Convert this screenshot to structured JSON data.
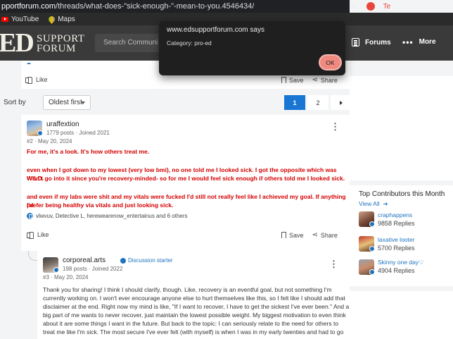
{
  "browser": {
    "url_host": "pportforum.com",
    "url_path": "/threads/what-does-\"sick-enough-\"-mean-to-you.4546434/",
    "ext_label": "Te",
    "bookmarks": [
      {
        "label": "YouTube",
        "icon": "youtube-icon"
      },
      {
        "label": "Maps",
        "icon": "maps-icon"
      }
    ]
  },
  "header": {
    "logo_mark": "ED",
    "logo_line1": "SUPPORT",
    "logo_line2": "FORUM",
    "search_placeholder": "Search Communi",
    "nav": [
      {
        "label": "Forums",
        "icon": "forums-icon"
      },
      {
        "label": "More",
        "icon": "more-dots-icon"
      }
    ]
  },
  "dialog": {
    "title": "www.edsupportforum.com says",
    "message": "Category: pro-ed",
    "ok_label": "OK"
  },
  "prev_post": {
    "like_label": "Like",
    "save_label": "Save",
    "share_label": "Share"
  },
  "sort": {
    "label": "Sort by",
    "selected": "Oldest first",
    "pages": [
      "1",
      "2"
    ],
    "current_page": "1"
  },
  "posts": [
    {
      "username": "uraffextion",
      "meta": "1779 posts · Joined 2021",
      "post_meta": "#2 · May 20, 2024",
      "paragraphs": [
        "For me, it's a look. It's how others treat me.",
        "even when I got down to my lowest (very low bmi), no one told me I looked sick. I got the opposite which was WILD.",
        "Won't go into it since you're recovery-minded- so for me I would feel sick enough if others told me I looked sick.",
        "and even if my labs were shit and my vitals were fucked I'd still not really feel like I achieved my goal. If anything I'd",
        "prefer being healthy via vitals and just looking sick."
      ],
      "reactions": "vlwvuv, Detective L, herewearenow_entertainus and 6 others",
      "like_label": "Like",
      "save_label": "Save",
      "share_label": "Share"
    },
    {
      "username": "corporeal.arts",
      "starter_label": "Discussion starter",
      "meta": "198 posts · Joined 2022",
      "post_meta": "#3 · May 20, 2024",
      "body_lines": [
        "Thank you for sharing! I think I should clarify, though. Like, recovery is an eventful goal, but not something I'm",
        "currently working on. I won't ever encourage anyone else to hurt themselves like this, so I felt like I should add that",
        "disclaimer at the end. Right now my mind is like, \"If I want to recover, I have to get the sickest I've ever been.\" And a",
        "big part of me wants to never recover, just maintain the lowest possible weight. My biggest motivation to even think",
        "about it are some things I want in the future. But back to the topic: I can seriously relate to the need for others to",
        "treat me like I'm sick. The most secure I've ever felt (with myself) is when I was in my early twenties and had to go"
      ]
    }
  ],
  "sidebar": {
    "title": "Top Contributors this Month",
    "view_all": "View All",
    "contributors": [
      {
        "name": "craphappens",
        "replies": "9858 Replies"
      },
      {
        "name": "laxative looter",
        "replies": "5700 Replies"
      },
      {
        "name": "Skinny one day♡",
        "replies": "4904 Replies"
      }
    ]
  },
  "colors": {
    "accent": "#1976d2",
    "post_red": "#d40000",
    "header_bg": "#3a3a3a",
    "dialog_bg": "#1f1f1f",
    "ok_button": "#f08a80"
  }
}
